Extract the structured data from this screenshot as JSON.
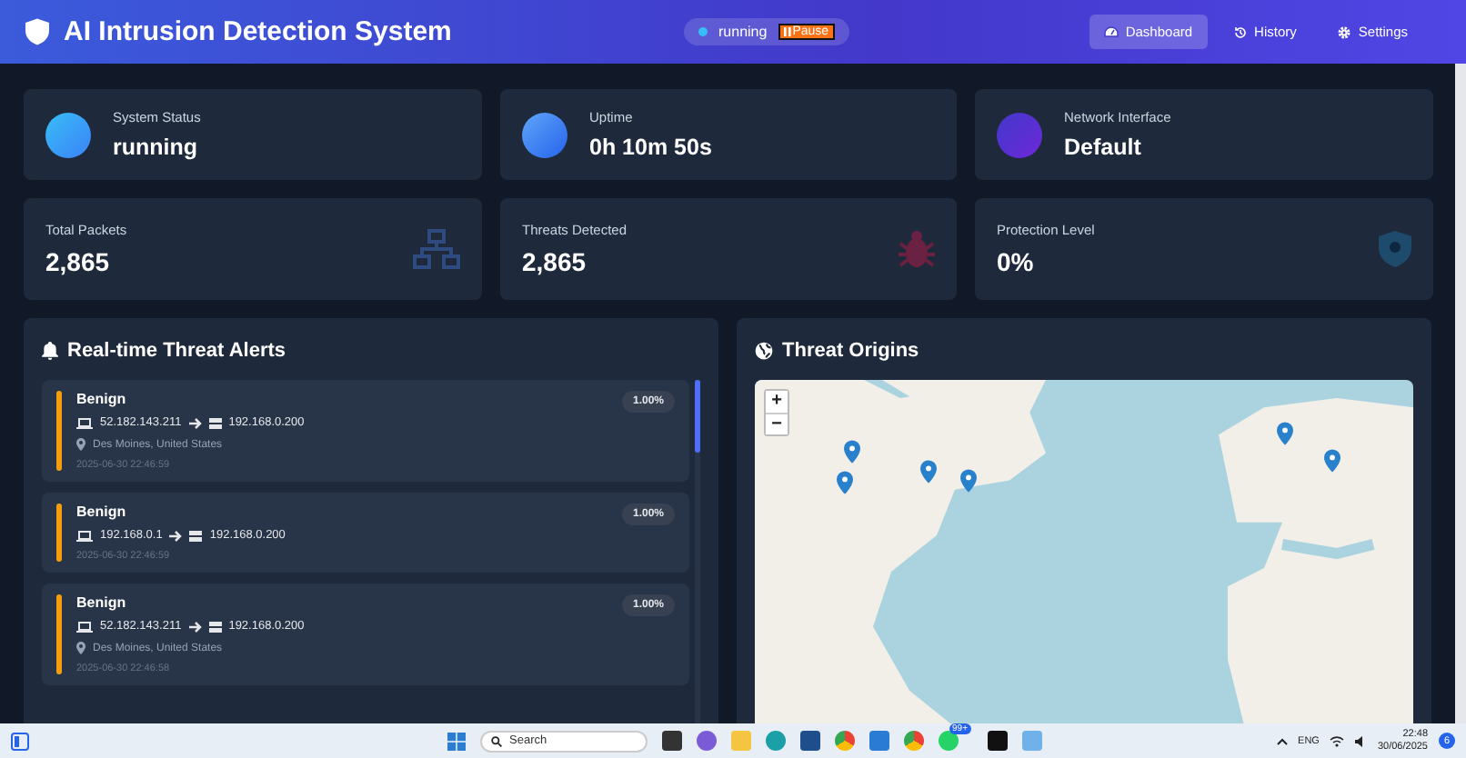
{
  "header": {
    "title": "AI Intrusion Detection System",
    "status": {
      "label": "running",
      "on": true
    },
    "pause_button": "Pause",
    "nav": [
      {
        "label": "Dashboard",
        "selected": true
      },
      {
        "label": "History",
        "selected": false
      },
      {
        "label": "Settings",
        "selected": false
      }
    ]
  },
  "status_cards": [
    {
      "label": "System Status",
      "value": "running"
    },
    {
      "label": "Uptime",
      "value": "0h 10m 50s"
    },
    {
      "label": "Network Interface",
      "value": "Default"
    }
  ],
  "metric_cards": [
    {
      "label": "Total Packets",
      "value": "2,865"
    },
    {
      "label": "Threats Detected",
      "value": "2,865"
    },
    {
      "label": "Protection Level",
      "value": "0%"
    }
  ],
  "alerts_panel": {
    "title": "Real-time Threat Alerts",
    "alerts": [
      {
        "type": "Benign",
        "confidence": "1.00%",
        "source": "52.182.143.211",
        "destination": "192.168.0.200",
        "location": "Des Moines, United States",
        "time": "2025-06-30 22:46:59",
        "color": "#f59e0b"
      },
      {
        "type": "Benign",
        "confidence": "1.00%",
        "source": "192.168.0.1",
        "destination": "192.168.0.200",
        "time": "2025-06-30 22:46:59",
        "color": "#f59e0b"
      },
      {
        "type": "Benign",
        "confidence": "1.00%",
        "source": "52.182.143.211",
        "destination": "192.168.0.200",
        "location": "Des Moines, United States",
        "time": "2025-06-30 22:46:58",
        "color": "#f59e0b"
      }
    ]
  },
  "map_panel": {
    "title": "Threat Origins",
    "zoom_in": "+",
    "zoom_out": "−"
  },
  "taskbar": {
    "search": "Search",
    "badge_count": "99+",
    "language": "ENG",
    "time": "22:48",
    "date": "30/06/2025",
    "notifications": "6"
  }
}
